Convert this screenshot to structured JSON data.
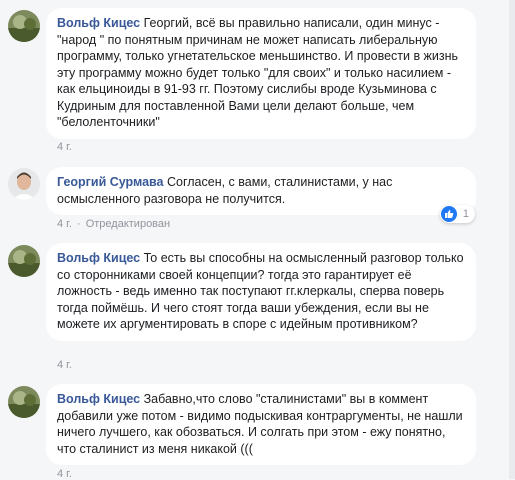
{
  "comments": [
    {
      "author": "Вольф Кицес",
      "text": "Георгий, всё вы правильно написали, один минус - \"народ \" по понятным причинам не может написать либеральную программу, только угнетательское меньшинство. И провести в жизнь эту программу можно будет только \"для своих\" и только насилием - как ельциноиды в 91-93 гг. Поэтому сислибы вроде Кузьминова с Кудриным для поставленной Вами цели делают больше, чем \"белоленточники\"",
      "time": "4 г."
    },
    {
      "author": "Георгий Сурмава",
      "text": "Согласен, с вами, сталинистами, у нас осмысленного разговора не получится.",
      "time": "4 г.",
      "edited": "Отредактирован",
      "reactions": "1"
    },
    {
      "author": "Вольф Кицес",
      "text": "То есть вы способны на осмысленный разговор только со сторонниками своей концепции? тогда это гарантирует её ложность - ведь именно так поступают гг.клеркалы, сперва поверь тогда поймёшь. И чего стоят тогда ваши убеждения, если вы не можете их аргументировать в споре с идейным противником?",
      "time": "4 г."
    },
    {
      "author": "Вольф Кицес",
      "text": "Забавно,что слово \"сталинистами\" вы в коммент добавили уже потом - видимо подыскивая контраргументы, не нашли ничего лучшего, как обозваться. И солгать при этом - ежу понятно, что сталинист из меня никакой (((",
      "time": "4 г."
    }
  ],
  "icons": {
    "like": "thumbs-up-icon",
    "avatar_wolf": "avatar-landscape",
    "avatar_georgy": "avatar-person"
  },
  "colors": {
    "author": "#385898",
    "like": "#2078f4",
    "background": "#f5f6f7"
  }
}
